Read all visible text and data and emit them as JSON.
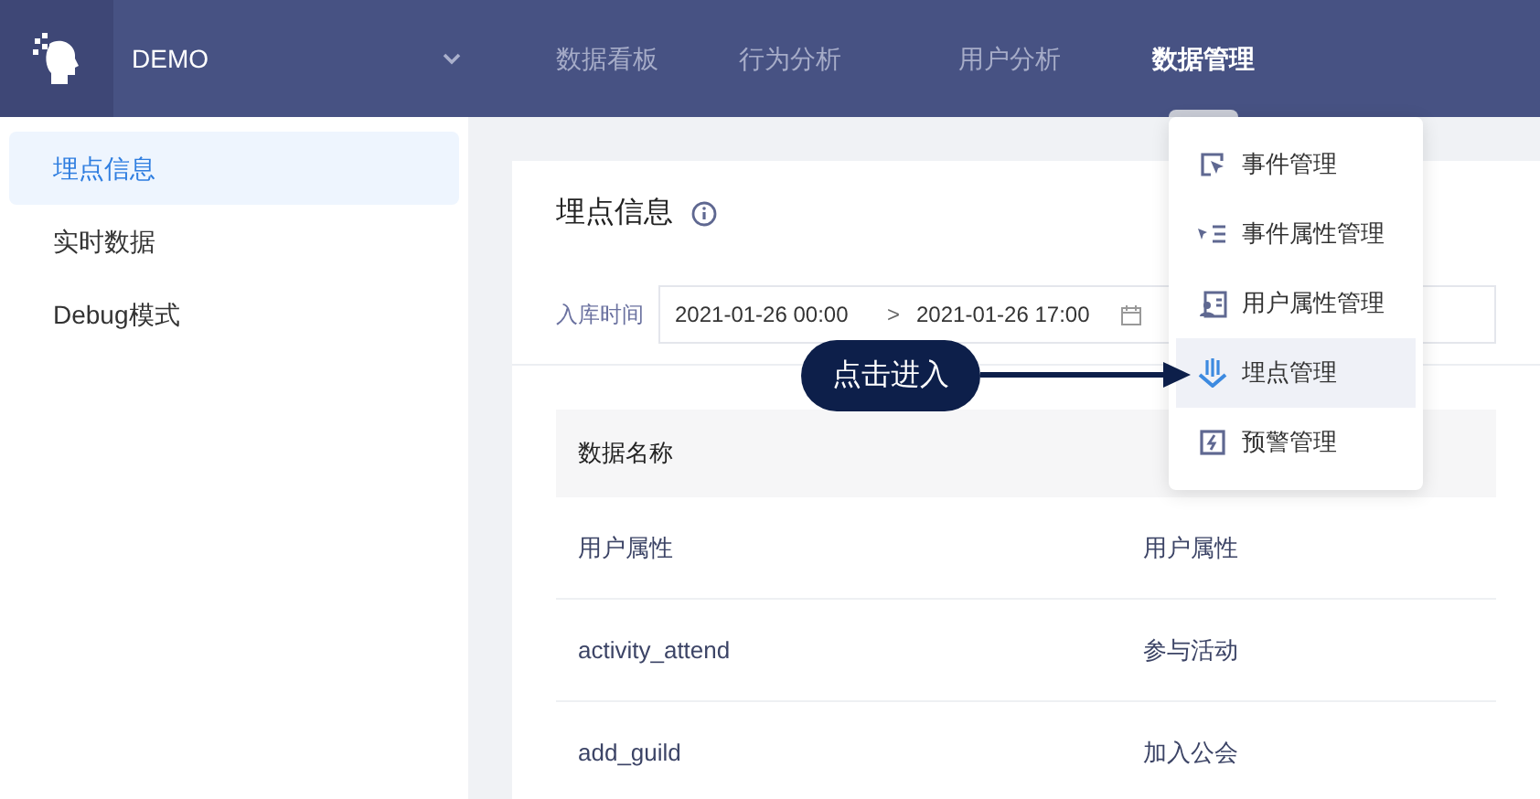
{
  "header": {
    "project": "DEMO",
    "tabs": [
      {
        "label": "数据看板",
        "selected": false
      },
      {
        "label": "行为分析",
        "selected": false
      },
      {
        "label": "用户分析",
        "selected": false
      },
      {
        "label": "数据管理",
        "selected": true
      }
    ]
  },
  "sidebar": {
    "items": [
      {
        "label": "埋点信息",
        "selected": true
      },
      {
        "label": "实时数据",
        "selected": false
      },
      {
        "label": "Debug模式",
        "selected": false
      }
    ]
  },
  "panel": {
    "title": "埋点信息",
    "filter_label": "入库时间",
    "date_start": "2021-01-26 00:00",
    "date_separator": ">",
    "date_end": "2021-01-26 17:00"
  },
  "table": {
    "columns": [
      "数据名称"
    ],
    "rows": [
      [
        "用户属性",
        "用户属性"
      ],
      [
        "activity_attend",
        "参与活动"
      ],
      [
        "add_guild",
        "加入公会"
      ]
    ]
  },
  "menu": {
    "items": [
      {
        "kind": "event",
        "label": "事件管理",
        "selected": false
      },
      {
        "kind": "event-attr",
        "label": "事件属性管理",
        "selected": false
      },
      {
        "kind": "user-attr",
        "label": "用户属性管理",
        "selected": false
      },
      {
        "kind": "tracking",
        "label": "埋点管理",
        "selected": true
      },
      {
        "kind": "alert",
        "label": "预警管理",
        "selected": false
      }
    ]
  },
  "callout": {
    "text": "点击进入"
  }
}
